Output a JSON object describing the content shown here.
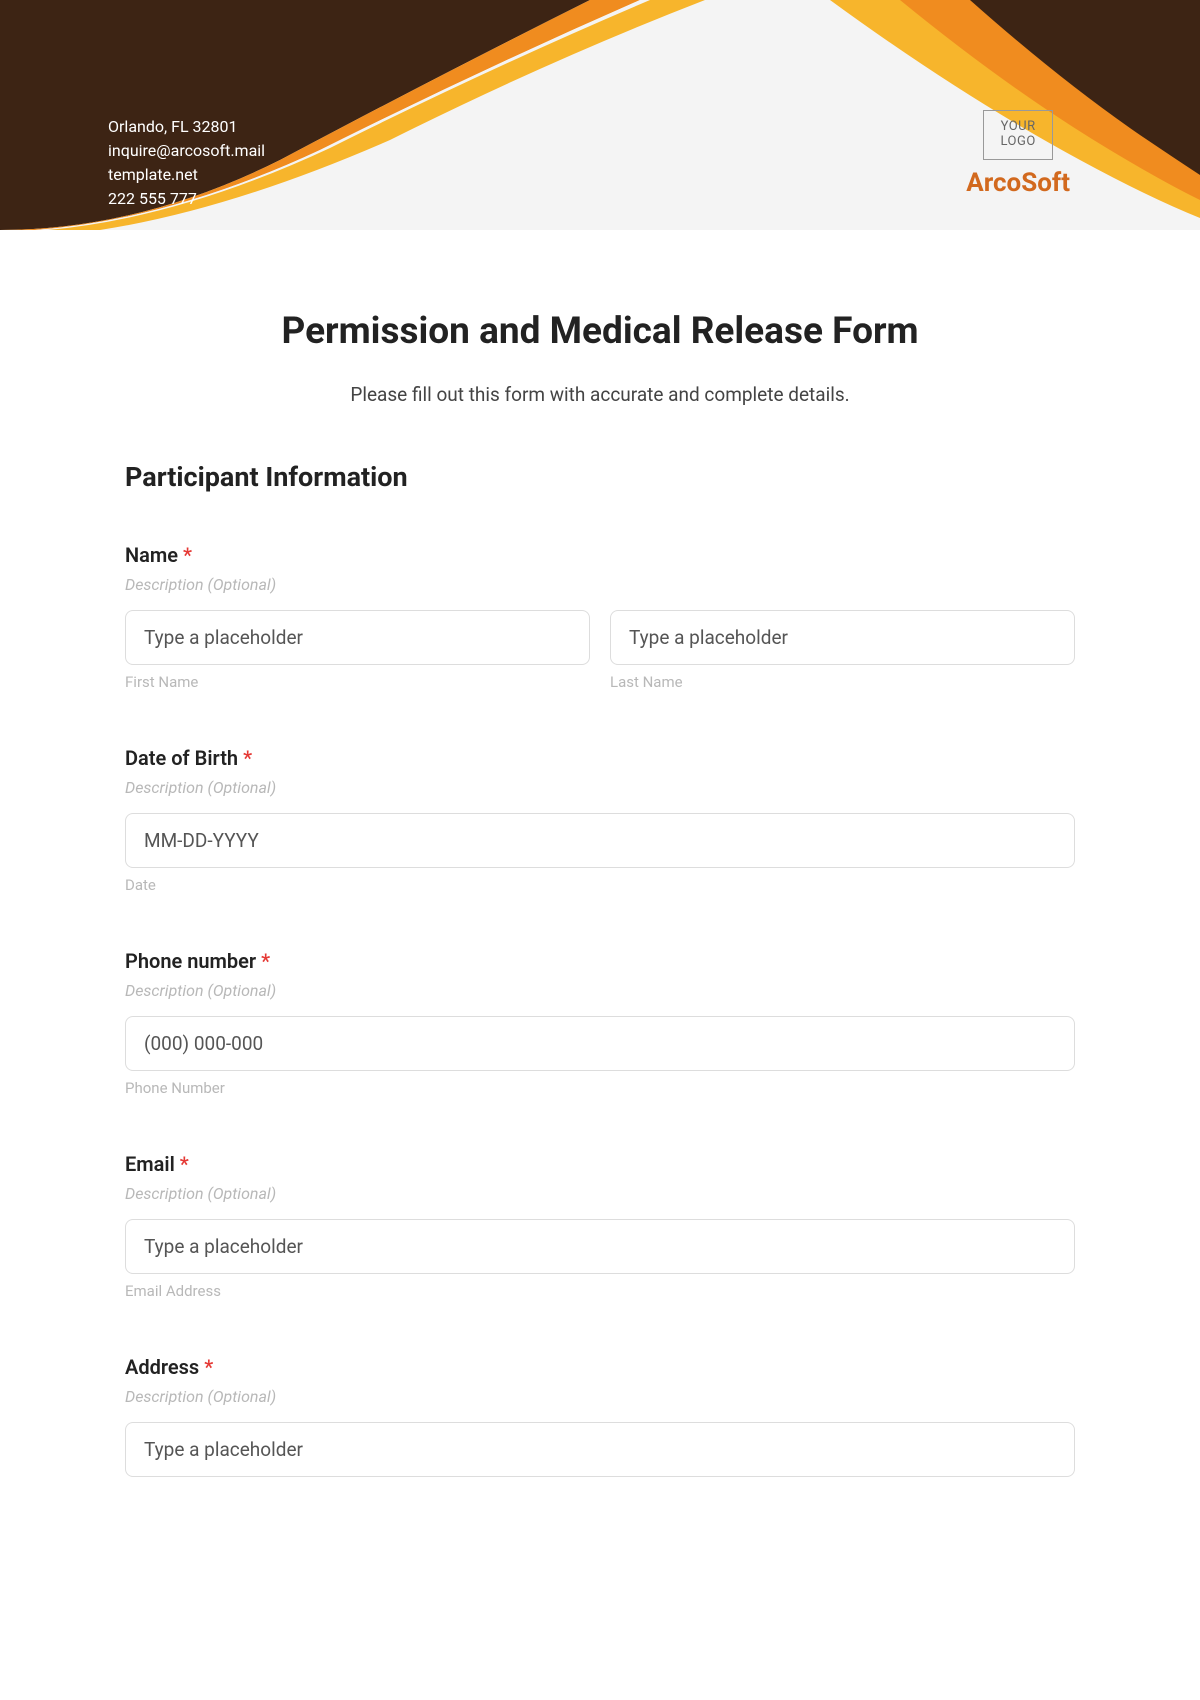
{
  "header": {
    "contact": {
      "address": "Orlando, FL 32801",
      "email": "inquire@arcosoft.mail",
      "website": "template.net",
      "phone": "222 555 777"
    },
    "logo_text_line1": "YOUR",
    "logo_text_line2": "LOGO",
    "company_name": "ArcoSoft"
  },
  "form": {
    "title": "Permission and Medical Release Form",
    "subtitle": "Please fill out this form with accurate and complete details.",
    "section_title": "Participant Information",
    "description_placeholder": "Description (Optional)",
    "required_marker": "*",
    "fields": {
      "name": {
        "label": "Name",
        "first_placeholder": "Type a placeholder",
        "last_placeholder": "Type a placeholder",
        "first_sublabel": "First Name",
        "last_sublabel": "Last Name"
      },
      "dob": {
        "label": "Date of Birth",
        "placeholder": "MM-DD-YYYY",
        "sublabel": "Date"
      },
      "phone": {
        "label": "Phone number",
        "placeholder": "(000) 000-000",
        "sublabel": "Phone Number"
      },
      "email": {
        "label": "Email",
        "placeholder": "Type a placeholder",
        "sublabel": "Email Address"
      },
      "address": {
        "label": "Address",
        "placeholder": "Type a placeholder"
      }
    }
  }
}
